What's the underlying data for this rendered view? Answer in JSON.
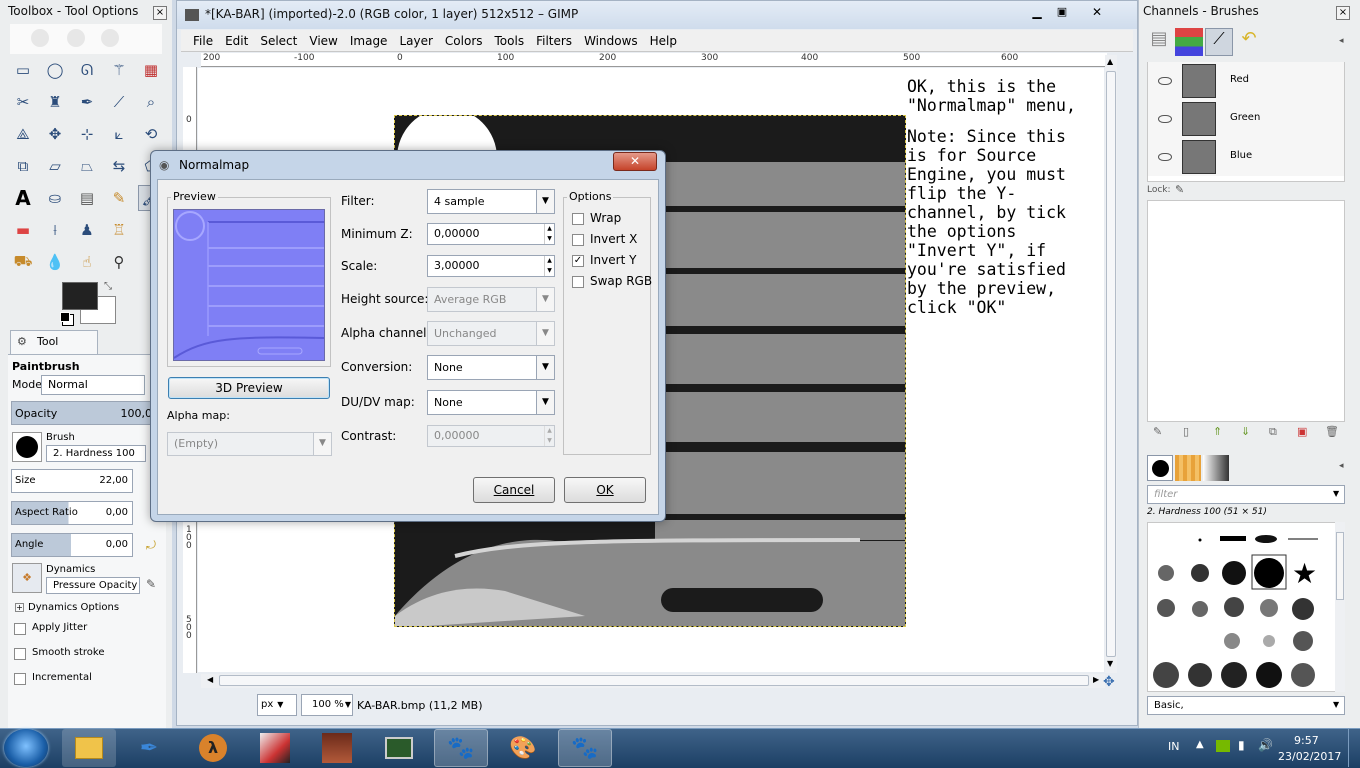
{
  "toolbox": {
    "title": "Toolbox - Tool Options",
    "close": "×"
  },
  "tool_options": {
    "tab": "Tool Options",
    "tool_name": "Paintbrush",
    "mode_label": "Mode:",
    "mode_value": "Normal",
    "opacity_label": "Opacity",
    "opacity_value": "100,0",
    "brush_label": "Brush",
    "brush_value": "2. Hardness 100",
    "size_label": "Size",
    "size_value": "22,00",
    "aspect_label": "Aspect Ratio",
    "aspect_value": "0,00",
    "angle_label": "Angle",
    "angle_value": "0,00",
    "dynamics_label": "Dynamics",
    "dynamics_value": "Pressure Opacity",
    "dynamics_options": "Dynamics Options",
    "apply_jitter": "Apply Jitter",
    "smooth_stroke": "Smooth stroke",
    "incremental": "Incremental"
  },
  "main_window": {
    "title": "*[KA-BAR] (imported)-2.0 (RGB color, 1 layer) 512x512 – GIMP",
    "menu": [
      "File",
      "Edit",
      "Select",
      "View",
      "Image",
      "Layer",
      "Colors",
      "Tools",
      "Filters",
      "Windows",
      "Help"
    ],
    "ruler_top": [
      "200",
      "-100",
      "0",
      "100",
      "200",
      "300",
      "400",
      "500",
      "600"
    ],
    "ruler_left": [
      "0",
      "1",
      "0",
      "0",
      "5",
      "0",
      "0"
    ],
    "status_unit": "px",
    "zoom": "100 %",
    "status_text": "KA-BAR.bmp (11,2 MB)"
  },
  "annotation": {
    "line1": "OK, this is the",
    "line2": "\"Normalmap\" menu,",
    "line3": "Note: Since this",
    "line4": "is for Source",
    "line5": "Engine, you must",
    "line6": "flip the Y-",
    "line7": "channel, by tick",
    "line8": "the options",
    "line9": "\"Invert Y\", if",
    "line10": "you're satisfied",
    "line11": "by the preview,",
    "line12": "click \"OK\""
  },
  "dialog": {
    "title": "Normalmap",
    "preview_label": "Preview",
    "preview_button": "3D Preview",
    "alpha_map_label": "Alpha map:",
    "alpha_map_value": "(Empty)",
    "filter_label": "Filter:",
    "filter_value": "4 sample",
    "minz_label": "Minimum Z:",
    "minz_value": "0,00000",
    "scale_label": "Scale:",
    "scale_value": "3,00000",
    "height_label": "Height source:",
    "height_value": "Average RGB",
    "alpha_channel_label": "Alpha channel:",
    "alpha_channel_value": "Unchanged",
    "conversion_label": "Conversion:",
    "conversion_value": "None",
    "dudv_label": "DU/DV map:",
    "dudv_value": "None",
    "contrast_label": "Contrast:",
    "contrast_value": "0,00000",
    "options_label": "Options",
    "options": [
      {
        "label": "Wrap",
        "checked": false
      },
      {
        "label": "Invert X",
        "checked": false
      },
      {
        "label": "Invert Y",
        "checked": true
      },
      {
        "label": "Swap RGB",
        "checked": false
      }
    ],
    "cancel": "Cancel",
    "ok": "OK",
    "close": "✕"
  },
  "channels": {
    "title": "Channels - Brushes",
    "items": [
      "Red",
      "Green",
      "Blue"
    ],
    "lock_label": "Lock:"
  },
  "brushes": {
    "filter_placeholder": "filter",
    "current_brush": "2. Hardness 100 (51 × 51)",
    "tag_value": "Basic,"
  },
  "taskbar": {
    "lang": "IN",
    "time": "9:57",
    "date": "23/02/2017"
  },
  "colors": {
    "dialog_preview": "#7f7ff5",
    "canvas_gray": "#8a8a8a",
    "canvas_dark": "#1b1b1b",
    "taskbar": "#1c3f64"
  }
}
